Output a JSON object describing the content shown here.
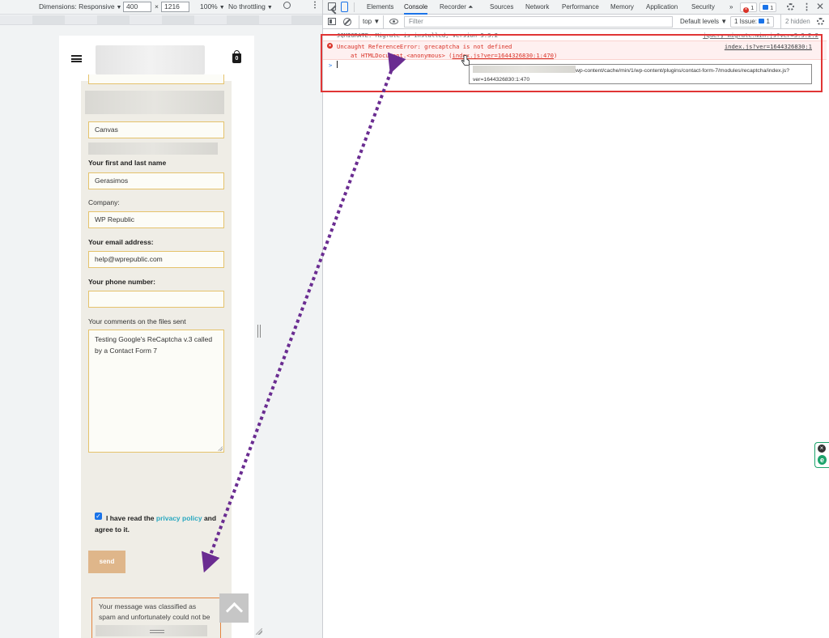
{
  "device_toolbar": {
    "dimensions_label": "Dimensions: Responsive",
    "width": "400",
    "times": "×",
    "height": "1216",
    "zoom": "100%",
    "throttling": "No throttling",
    "caret": "▼",
    "more": "⋮"
  },
  "site": {
    "cart_count": "0",
    "form": {
      "field_canvas": "Canvas",
      "name_label": "Your first and last name",
      "name_value": "Gerasimos",
      "company_label": "Company:",
      "company_value": "WP Republic",
      "email_label": "Your email address:",
      "email_value": "help@wprepublic.com",
      "phone_label": "Your phone number:",
      "phone_value": "",
      "comments_label": "Your comments on the files sent",
      "comments_value": "Testing Google's ReCaptcha v.3 called by a Contact Form 7",
      "privacy_checked": "✓",
      "privacy_prefix": "I have read the ",
      "privacy_link": "privacy policy",
      "privacy_suffix": " and agree to it.",
      "send_label": "send",
      "response_message": "Your message was classified as spam and unfortunately could not be sent."
    }
  },
  "devtools": {
    "tabs": [
      {
        "label": "Elements"
      },
      {
        "label": "Console"
      },
      {
        "label": "Recorder ⏶"
      },
      {
        "label": "Sources"
      },
      {
        "label": "Network"
      },
      {
        "label": "Performance"
      },
      {
        "label": "Memory"
      },
      {
        "label": "Application"
      },
      {
        "label": "Security"
      },
      {
        "label": "»"
      }
    ],
    "error_badge": "1",
    "info_badge": "1",
    "close": "✕",
    "kebab": "⋮",
    "console_toolbar": {
      "context": "top ▼",
      "filter_placeholder": "Filter",
      "levels": "Default levels ▼",
      "issues": "1 Issue:",
      "issues_count": "1",
      "hidden": "2 hidden"
    },
    "console": {
      "prev_message": "JQMIGRATE: Migrate is installed, version 3.3.2",
      "prev_source": "jquery-migrate.min.js?ver=3.3.2:2",
      "error_line1": "Uncaught ReferenceError: grecaptcha is not defined",
      "error_line2_prefix": "at HTMLDocument.<anonymous> (",
      "error_link": "index.js?ver=1644326830:1:470",
      "error_line2_suffix": ")",
      "error_source": "index.js?ver=1644326830:1",
      "prompt": ">",
      "tooltip_path": "wp-content/cache/min/1/wp-content/plugins/contact-form-7/modules/recaptcha/index.js?",
      "tooltip_line2": "ver=1644326830:1:470"
    }
  },
  "colors": {
    "highlight": "#e03535",
    "arrow": "#6a2c91",
    "field_border": "#e5c26b",
    "message_border": "#e2843e",
    "send_button": "#dfb68a",
    "link": "#2aa8c0"
  }
}
